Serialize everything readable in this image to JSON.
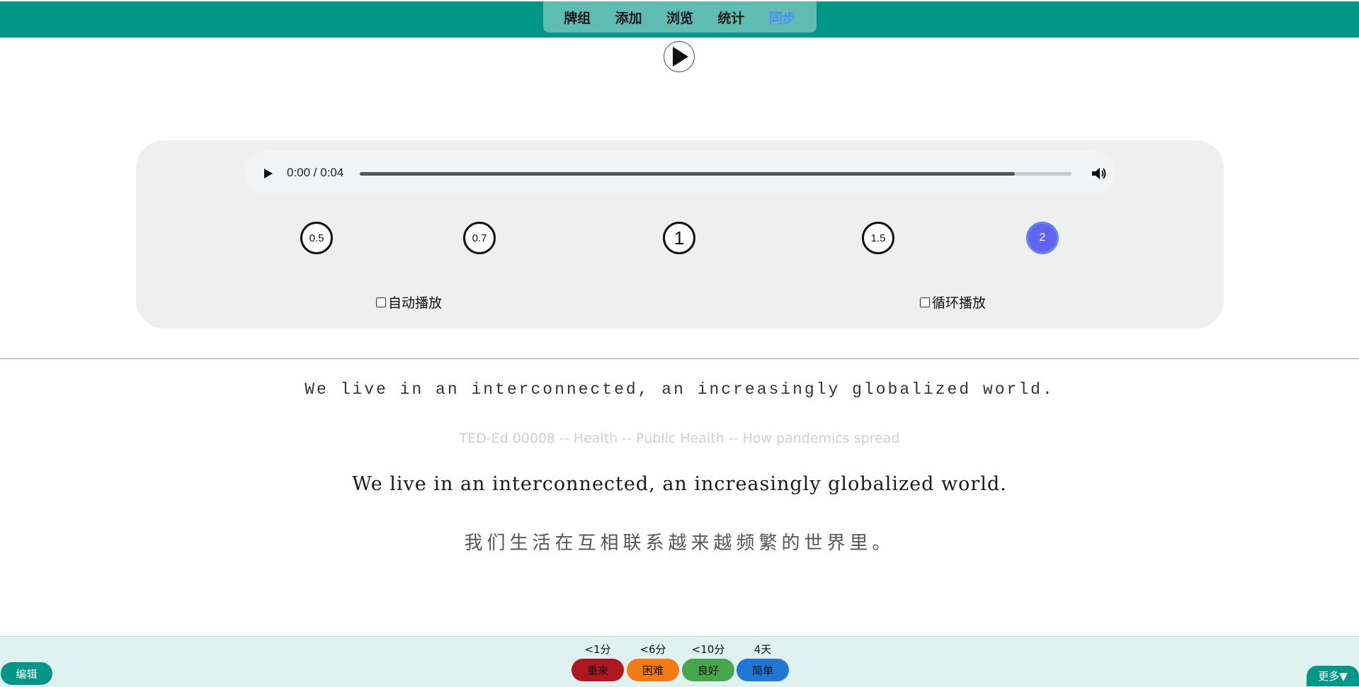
{
  "nav": {
    "tabs": [
      "牌组",
      "添加",
      "浏览",
      "统计",
      "同步"
    ],
    "active_tab": "同步",
    "active_color": "#4d8ef8",
    "bar_color": "#009688"
  },
  "player": {
    "time": "0:00 / 0:04",
    "progress_fraction": 0.92,
    "speeds": [
      "0.5",
      "0.7",
      "1",
      "1.5",
      "2"
    ],
    "active_speed": "2",
    "autoplay_label": "自动播放",
    "loop_label": "循环播放",
    "autoplay_checked": false,
    "loop_checked": false
  },
  "card": {
    "sentence_mono": "We live in an interconnected, an increasingly globalized world.",
    "source": "TED-Ed 00008 -- Health -- Public Health -- How pandemics spread",
    "sentence_en": "We live in an interconnected, an increasingly globalized world.",
    "sentence_zh": "我们生活在互相联系越来越频繁的世界里。"
  },
  "footer": {
    "edit_label": "编辑",
    "more_label": "更多▼",
    "answers": [
      {
        "interval": "<1分",
        "label": "重来",
        "color": "#b0161d"
      },
      {
        "interval": "<6分",
        "label": "困难",
        "color": "#f47b14"
      },
      {
        "interval": "<10分",
        "label": "良好",
        "color": "#45a64a"
      },
      {
        "interval": "4天",
        "label": "简单",
        "color": "#1f78d6"
      }
    ]
  }
}
